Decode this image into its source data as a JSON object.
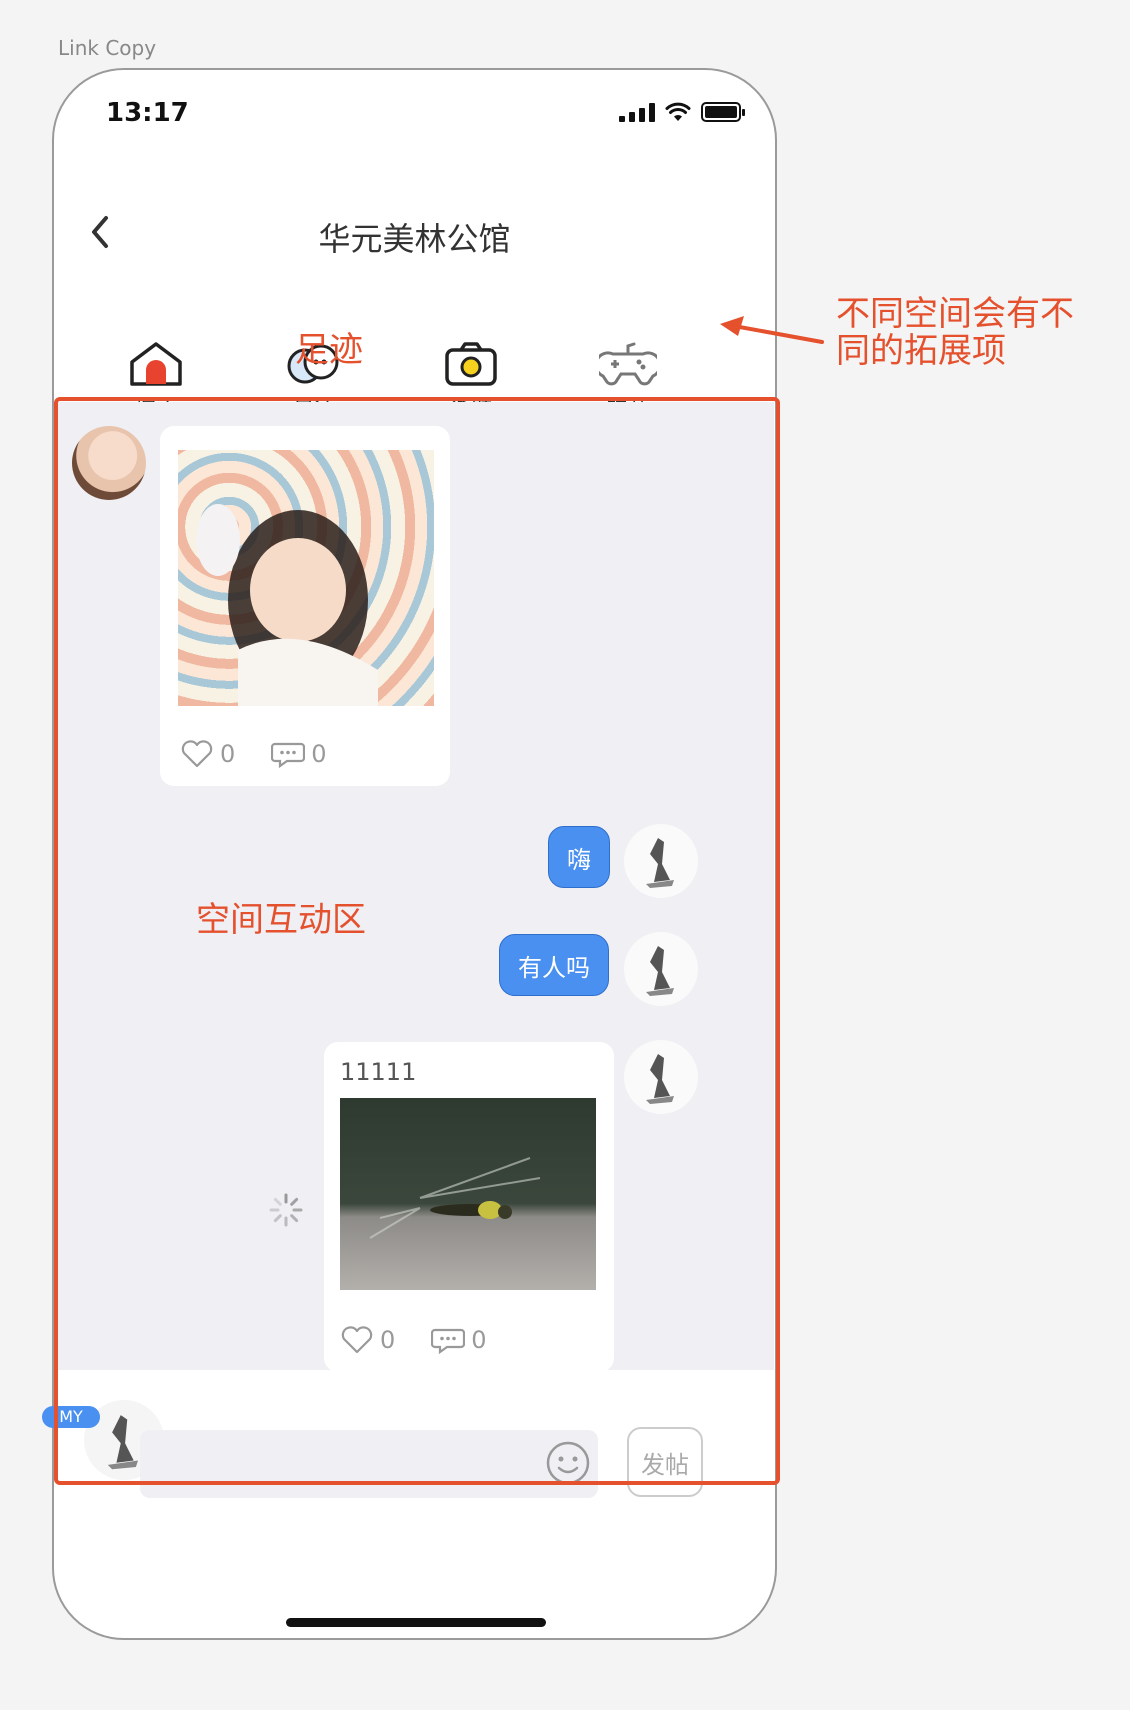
{
  "canvas_label": "Link Copy",
  "status_bar": {
    "time": "13:17"
  },
  "navbar": {
    "title": "华元美林公馆"
  },
  "tabs": [
    {
      "label": "探店",
      "icon": "house-icon"
    },
    {
      "label": "足迹",
      "icon": "chat-bubbles-icon"
    },
    {
      "label": "话题",
      "icon": "camera-icon"
    },
    {
      "label": "玩儿",
      "icon": "gamepad-icon"
    }
  ],
  "tab_overlay_annotation": "足迹",
  "chat": {
    "posts": [
      {
        "type": "photo_post",
        "side": "left",
        "text": "",
        "likes": "0",
        "comments": "0"
      },
      {
        "type": "text_bubble",
        "side": "right",
        "text": "嗨"
      },
      {
        "type": "text_bubble",
        "side": "right",
        "text": "有人吗"
      },
      {
        "type": "photo_post",
        "side": "right",
        "text": "11111",
        "likes": "0",
        "comments": "0",
        "sending": true
      }
    ],
    "area_annotation": "空间互动区"
  },
  "bottom_bar": {
    "my_badge": "MY",
    "input_value": "",
    "input_placeholder": "",
    "post_button": "发帖"
  },
  "annotation": {
    "text": "不同空间会有不同的拓展项"
  },
  "colors": {
    "accent": "#4a90f0",
    "annotation": "#e5502d",
    "chat_bg": "#efeff4"
  }
}
